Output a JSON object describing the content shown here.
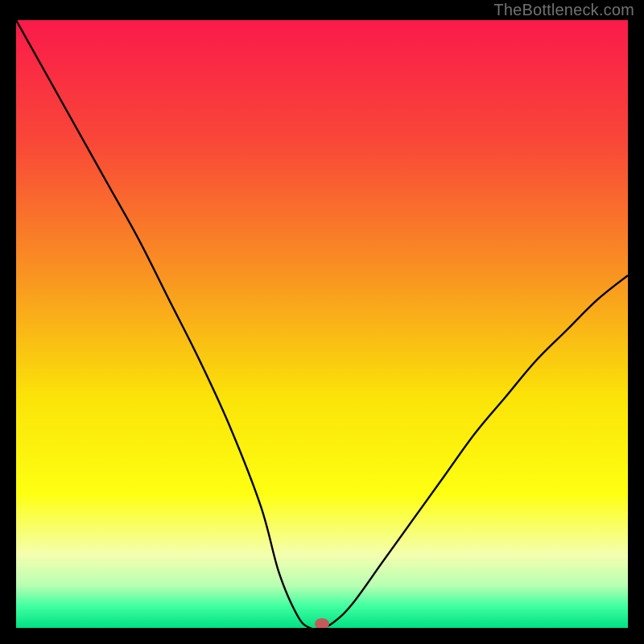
{
  "watermark": "TheBottleneck.com",
  "chart_data": {
    "type": "line",
    "title": "",
    "xlabel": "",
    "ylabel": "",
    "xlim": [
      0,
      100
    ],
    "ylim": [
      0,
      100
    ],
    "series": [
      {
        "name": "curve",
        "x": [
          0,
          5,
          10,
          15,
          20,
          25,
          30,
          35,
          40,
          43,
          46,
          48,
          50,
          52,
          55,
          60,
          65,
          70,
          75,
          80,
          85,
          90,
          95,
          100
        ],
        "y": [
          100,
          91,
          82,
          73,
          64,
          54,
          44,
          33,
          20,
          9,
          2,
          0,
          0,
          1,
          4,
          11,
          18,
          25,
          32,
          38,
          44,
          49,
          54,
          58
        ]
      }
    ],
    "marker": {
      "x": 50,
      "y": 0
    },
    "gradient_stops": [
      {
        "offset": 0.0,
        "color": "#fa1a4a"
      },
      {
        "offset": 0.2,
        "color": "#f94738"
      },
      {
        "offset": 0.42,
        "color": "#f99421"
      },
      {
        "offset": 0.62,
        "color": "#fbe308"
      },
      {
        "offset": 0.78,
        "color": "#feff12"
      },
      {
        "offset": 0.88,
        "color": "#f4ffb0"
      },
      {
        "offset": 0.93,
        "color": "#b8ffb2"
      },
      {
        "offset": 0.965,
        "color": "#3effa0"
      },
      {
        "offset": 1.0,
        "color": "#00e183"
      }
    ]
  }
}
